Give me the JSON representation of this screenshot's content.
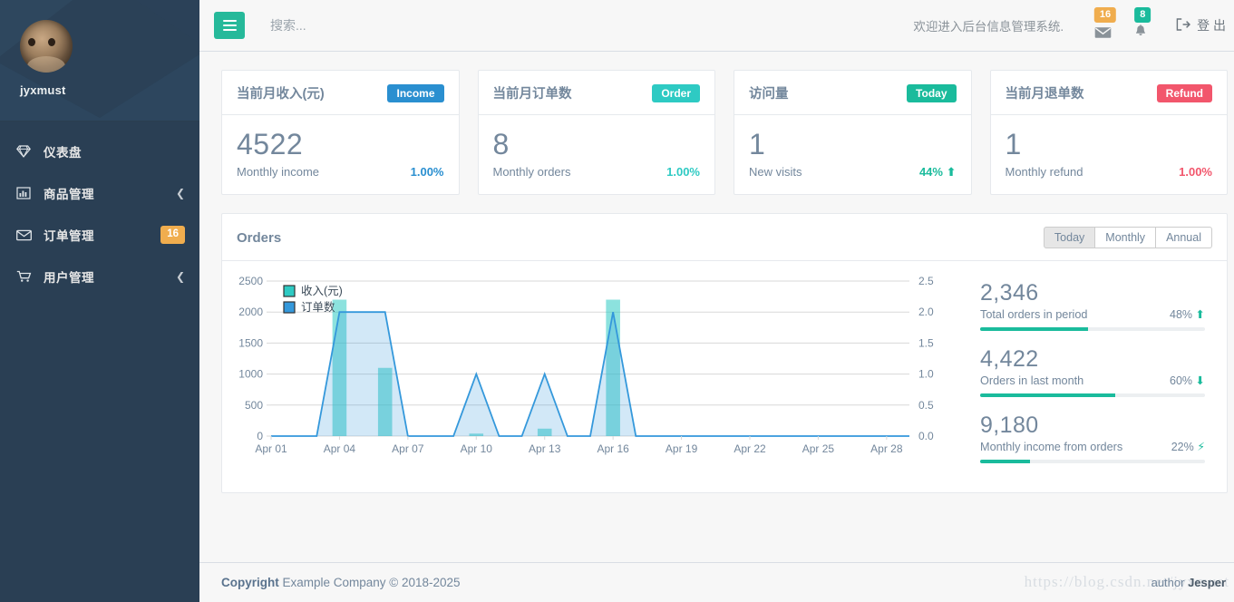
{
  "sidebar": {
    "profile": {
      "name": "jyxmust",
      "avatar_icon": "user-avatar"
    },
    "items": [
      {
        "label": "仪表盘",
        "icon": "diamond-icon",
        "badge": null,
        "chevron": false
      },
      {
        "label": "商品管理",
        "icon": "bar-chart-icon",
        "badge": null,
        "chevron": true
      },
      {
        "label": "订单管理",
        "icon": "envelope-icon",
        "badge": "16",
        "chevron": false
      },
      {
        "label": "用户管理",
        "icon": "cart-icon",
        "badge": null,
        "chevron": true
      }
    ]
  },
  "topnav": {
    "menu_toggle_icon": "hamburger-icon",
    "search_placeholder": "搜索...",
    "search_value": "",
    "welcome": "欢迎进入后台信息管理系统.",
    "mail_badge": "16",
    "bell_badge": "8",
    "logout_label": "登 出",
    "logout_icon": "sign-out-icon"
  },
  "tiles": [
    {
      "title": "当前月收入(元)",
      "pill": "Income",
      "pill_color": "#2A8FD0",
      "value": "4522",
      "sub": "Monthly income",
      "pct": "1.00%",
      "pct_color": "#2A8FD0",
      "trend_icon": "none"
    },
    {
      "title": "当前月订单数",
      "pill": "Order",
      "pill_color": "#2ECAC3",
      "value": "8",
      "sub": "Monthly orders",
      "pct": "1.00%",
      "pct_color": "#2ECAC3",
      "trend_icon": "none"
    },
    {
      "title": "访问量",
      "pill": "Today",
      "pill_color": "#1ABB9C",
      "value": "1",
      "sub": "New visits",
      "pct": "44%",
      "pct_color": "#1ABB9C",
      "trend_icon": "arrow-up-icon"
    },
    {
      "title": "当前月退单数",
      "pill": "Refund",
      "pill_color": "#F2566C",
      "value": "1",
      "sub": "Monthly refund",
      "pct": "1.00%",
      "pct_color": "#F2566C",
      "trend_icon": "none"
    }
  ],
  "panel": {
    "title": "Orders",
    "tabs": [
      {
        "label": "Today",
        "active": true
      },
      {
        "label": "Monthly",
        "active": false
      },
      {
        "label": "Annual",
        "active": false
      }
    ],
    "stats": [
      {
        "value": "2,346",
        "label": "Total orders in period",
        "pct": "48%",
        "trend_icon": "arrow-up-icon",
        "progress": 48
      },
      {
        "value": "4,422",
        "label": "Orders in last month",
        "pct": "60%",
        "trend_icon": "arrow-down-icon",
        "progress": 60
      },
      {
        "value": "9,180",
        "label": "Monthly income from orders",
        "pct": "22%",
        "trend_icon": "bolt-icon",
        "progress": 22
      }
    ]
  },
  "chart_data": {
    "type": "line",
    "title": "Orders",
    "xlabel": "",
    "ylabel": "",
    "grid": true,
    "legend_position": "top-left",
    "x_tick_labels": [
      "Apr 01",
      "Apr 04",
      "Apr 07",
      "Apr 10",
      "Apr 13",
      "Apr 16",
      "Apr 19",
      "Apr 22",
      "Apr 25",
      "Apr 28"
    ],
    "y_left_ticks": [
      0,
      500,
      1000,
      1500,
      2000,
      2500
    ],
    "y_left_range": [
      0,
      2500
    ],
    "y_right_ticks": [
      "0.0",
      "0.5",
      "1.0",
      "1.5",
      "2.0",
      "2.5"
    ],
    "y_right_range": [
      0,
      2.5
    ],
    "x_days": [
      "Apr 01",
      "Apr 02",
      "Apr 03",
      "Apr 04",
      "Apr 05",
      "Apr 06",
      "Apr 07",
      "Apr 08",
      "Apr 09",
      "Apr 10",
      "Apr 11",
      "Apr 12",
      "Apr 13",
      "Apr 14",
      "Apr 15",
      "Apr 16",
      "Apr 17",
      "Apr 18",
      "Apr 19",
      "Apr 20",
      "Apr 21",
      "Apr 22",
      "Apr 23",
      "Apr 24",
      "Apr 25",
      "Apr 26",
      "Apr 27",
      "Apr 28",
      "Apr 29"
    ],
    "series": [
      {
        "name": "收入(元)",
        "type": "bar",
        "color": "#2ECAC3",
        "axis": "left",
        "values": [
          0,
          0,
          0,
          2200,
          0,
          1100,
          0,
          0,
          0,
          40,
          0,
          0,
          120,
          0,
          0,
          2200,
          0,
          0,
          0,
          0,
          0,
          0,
          0,
          0,
          0,
          0,
          0,
          0,
          0
        ]
      },
      {
        "name": "订单数",
        "type": "line-area",
        "color": "#3498DB",
        "axis": "left",
        "values": [
          0,
          0,
          0,
          2000,
          2000,
          2000,
          0,
          0,
          0,
          1000,
          0,
          0,
          1000,
          0,
          0,
          2000,
          0,
          0,
          0,
          0,
          0,
          0,
          0,
          0,
          0,
          0,
          0,
          0,
          0
        ]
      }
    ]
  },
  "footer": {
    "copyright_bold": "Copyright",
    "copyright_text": " Example Company © 2018-2025",
    "author_label": "author ",
    "author_name": "Jesper",
    "watermark": "https://blog.csdn.net/jyxmust"
  }
}
